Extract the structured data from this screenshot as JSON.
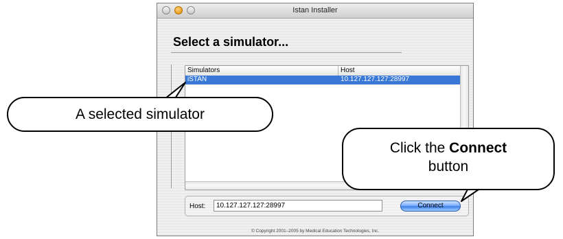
{
  "window": {
    "title": "Istan Installer"
  },
  "page": {
    "heading": "Select a simulator..."
  },
  "table": {
    "columns": [
      "Simulators",
      "Host"
    ],
    "rows": [
      {
        "simulator": "iSTAN",
        "host": "10.127.127.127:28997",
        "selected": true
      }
    ]
  },
  "host": {
    "label": "Host:",
    "value": "10.127.127.127:28997"
  },
  "connect_button": {
    "label": "Connect"
  },
  "footer": {
    "copyright": "© Copyright 2001–2005 by Medical Education Technologies, Inc."
  },
  "callouts": {
    "selected_simulator": "A selected simulator",
    "connect_prefix": "Click the",
    "connect_bold": "Connect",
    "connect_suffix": "button"
  },
  "colors": {
    "selection": "#3a78d8",
    "button": "#3f80e8"
  }
}
